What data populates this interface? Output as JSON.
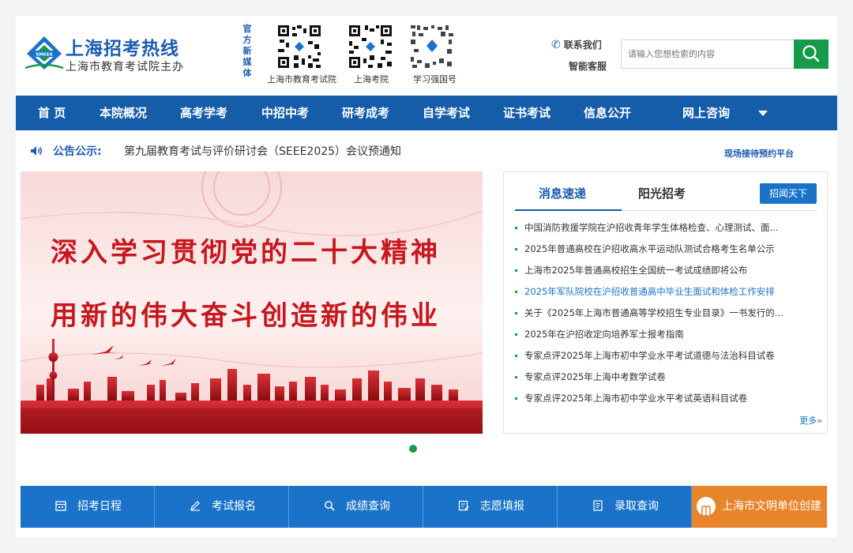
{
  "header": {
    "logo_title": "上海招考热线",
    "logo_subtitle": "上海市教育考试院主办",
    "logo_badge": "SMEEA",
    "media_label": "官方新媒体",
    "qr_codes": [
      {
        "caption": "上海市教育考试院"
      },
      {
        "caption": "上海考院"
      },
      {
        "caption": "学习强国号"
      }
    ],
    "contact_label": "联系我们",
    "service_label": "智能客服",
    "search_placeholder": "请输入您想检索的内容"
  },
  "nav": {
    "items": [
      "首 页",
      "本院概况",
      "高考学考",
      "中招中考",
      "研考成考",
      "自学考试",
      "证书考试",
      "信息公开",
      "网上咨询"
    ]
  },
  "notice": {
    "label": "公告公示:",
    "text": "第九届教育考试与评价研讨会（SEEE2025）会议预通知",
    "link": "现场接待预约平台"
  },
  "banner": {
    "line1": "深入学习贯彻党的二十大精神",
    "line2": "用新的伟大奋斗创造新的伟业"
  },
  "news": {
    "tab_active": "消息速递",
    "tab_other": "阳光招考",
    "button": "招闻天下",
    "items": [
      "中国消防救援学院在沪招收青年学生体格检查、心理测试、面...",
      "2025年普通高校在沪招收高水平运动队测试合格考生名单公示",
      "上海市2025年普通高校招生全国统一考试成绩即将公布",
      "2025年军队院校在沪招收普通高中毕业生面试和体检工作安排",
      "关于《2025年上海市普通高等学校招生专业目录》一书发行的...",
      "2025年在沪招收定向培养军士报考指南",
      "专家点评2025年上海市初中学业水平考试道德与法治科目试卷",
      "专家点评2025年上海中考数学试卷",
      "专家点评2025年上海市初中学业水平考试英语科目试卷"
    ],
    "highlighted_index": 3,
    "more": "更多»"
  },
  "quick_links": [
    {
      "label": "招考日程",
      "icon": "calendar-icon"
    },
    {
      "label": "考试报名",
      "icon": "pencil-icon"
    },
    {
      "label": "成绩查询",
      "icon": "search-icon"
    },
    {
      "label": "志愿填报",
      "icon": "form-edit-icon"
    },
    {
      "label": "录取查询",
      "icon": "document-icon"
    },
    {
      "label": "上海市文明单位创建",
      "icon": "book-icon"
    }
  ],
  "colors": {
    "brand_blue": "#155ca9",
    "accent_green": "#159b4a",
    "tile_blue": "#1a73c8",
    "tile_orange": "#e8842a",
    "banner_red": "#c8161e"
  }
}
